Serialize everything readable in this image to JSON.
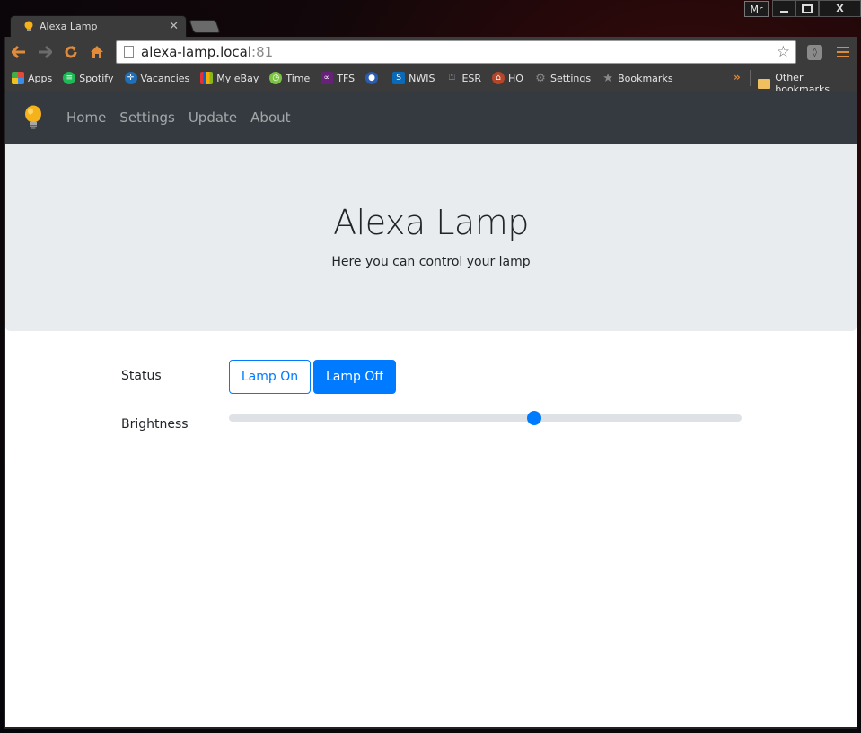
{
  "window": {
    "profile": "Mr",
    "close_label": "X"
  },
  "tab": {
    "title": "Alexa Lamp",
    "close_label": "✕"
  },
  "omnibox": {
    "host": "alexa-lamp.local",
    "port": ":81"
  },
  "bookmarks": [
    {
      "label": "Apps",
      "icon": "apps-grid-icon",
      "color": "#e34a3a"
    },
    {
      "label": "Spotify",
      "icon": "spotify-icon",
      "color": "#1db954"
    },
    {
      "label": "Vacancies",
      "icon": "vacancies-icon",
      "color": "#1e6fb8"
    },
    {
      "label": "My eBay",
      "icon": "ebay-icon",
      "color": "#e53238"
    },
    {
      "label": "Time",
      "icon": "time-icon",
      "color": "#7cc243"
    },
    {
      "label": "TFS",
      "icon": "visual-studio-icon",
      "color": "#68217a"
    },
    {
      "label": "",
      "icon": "circle-logo-icon",
      "color": "#2a5db0"
    },
    {
      "label": "NWIS",
      "icon": "sharepoint-icon",
      "color": "#0a6ab8"
    },
    {
      "label": "ESR",
      "icon": "key-icon",
      "color": "#9ab"
    },
    {
      "label": "HO",
      "icon": "ho-icon",
      "color": "#b5462a"
    },
    {
      "label": "Settings",
      "icon": "gear-icon",
      "color": "#777"
    },
    {
      "label": "Bookmarks",
      "icon": "star-icon",
      "color": "#777"
    }
  ],
  "other_bookmarks": "Other bookmarks",
  "navbar": {
    "links": [
      "Home",
      "Settings",
      "Update",
      "About"
    ]
  },
  "hero": {
    "title": "Alexa Lamp",
    "subtitle": "Here you can control your lamp"
  },
  "controls": {
    "status_label": "Status",
    "lamp_on_label": "Lamp On",
    "lamp_off_label": "Lamp Off",
    "brightness_label": "Brightness",
    "brightness_value": 0.595
  },
  "colors": {
    "primary": "#007bff",
    "navbar_bg": "#343a40",
    "hero_bg": "#e9ecef",
    "chrome_accent": "#e08a3c"
  }
}
